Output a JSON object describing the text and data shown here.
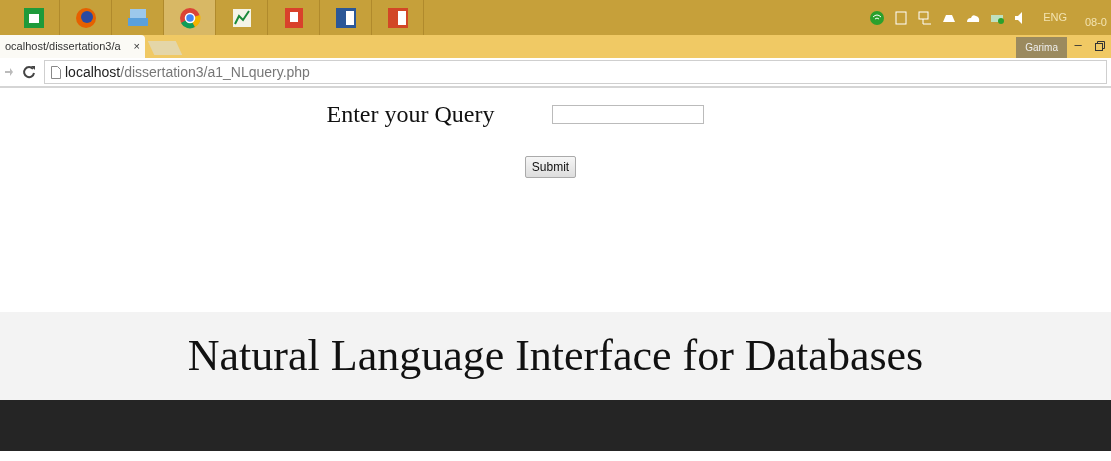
{
  "tray": {
    "language": "ENG",
    "clock": "08-0"
  },
  "browser": {
    "tab": {
      "title": "ocalhost/dissertation3/a",
      "close": "×",
      "selected": true
    },
    "profile": "Garima",
    "window_controls": [
      "–"
    ],
    "url": {
      "host": "localhost",
      "path": "/dissertation3/a1_NLquery.php"
    }
  },
  "form": {
    "label": "Enter your Query",
    "submit": "Submit"
  },
  "banner": {
    "title": "Natural Language Interface for Databases"
  }
}
